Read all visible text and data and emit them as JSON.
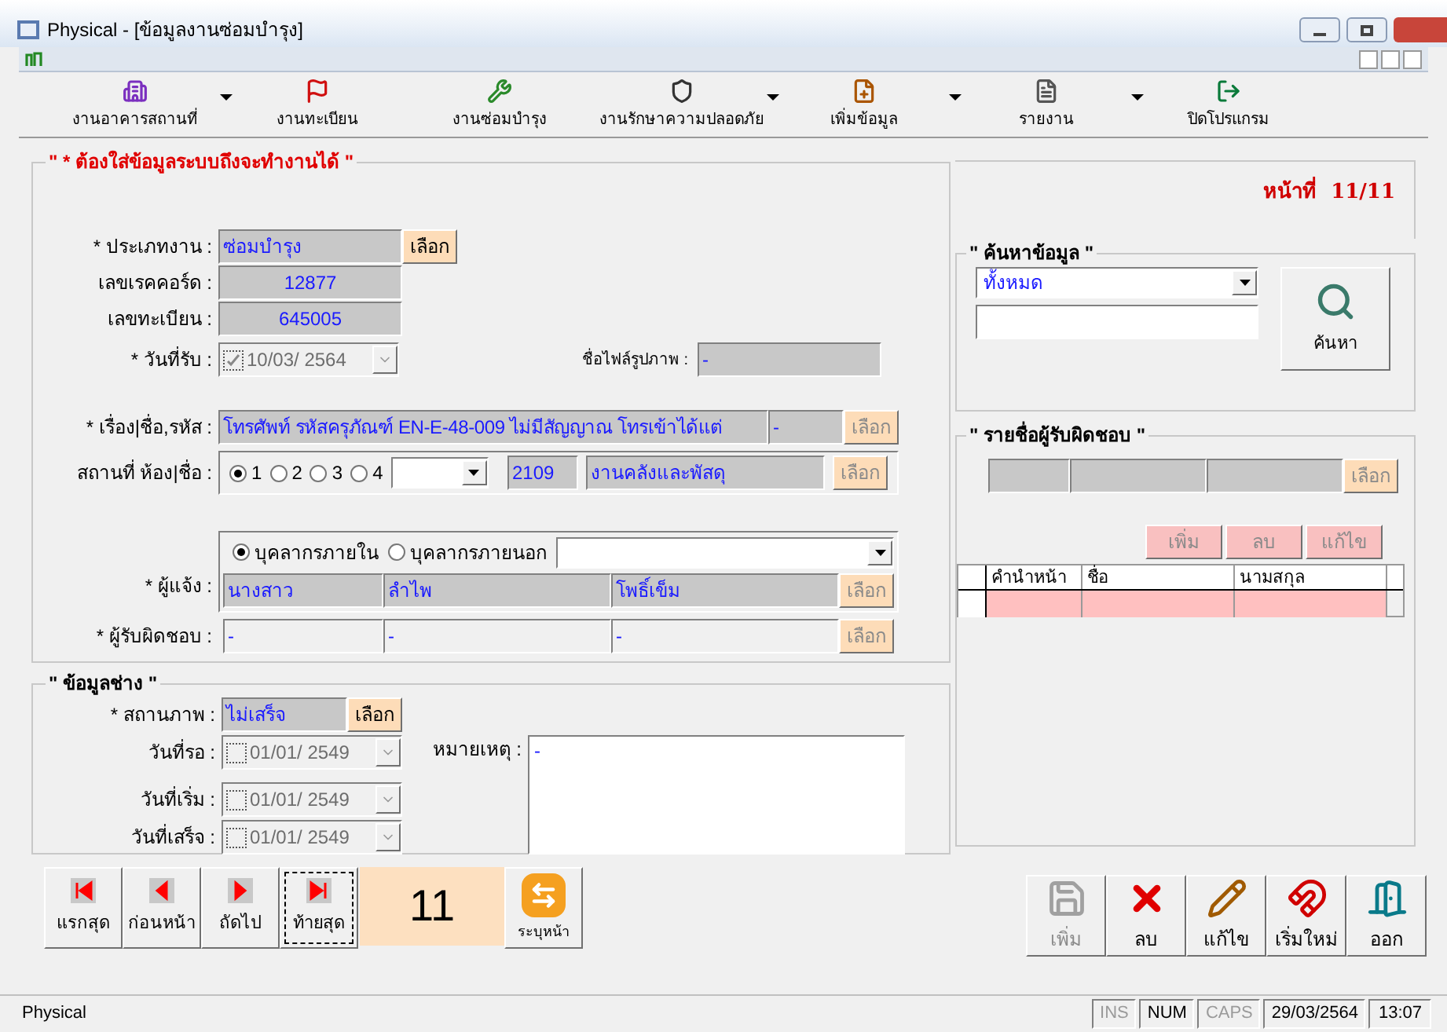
{
  "window": {
    "title": "Physical - [ข้อมูลงานซ่อมบำรุง]"
  },
  "toolbar": [
    {
      "label": "งานอาคารสถานที่",
      "kind": "building",
      "dropdown": true
    },
    {
      "label": "งานทะเบียน",
      "kind": "register",
      "dropdown": false
    },
    {
      "label": "งานซ่อมบำรุง",
      "kind": "repair",
      "dropdown": false
    },
    {
      "label": "งานรักษาความปลอดภัย",
      "kind": "security",
      "dropdown": true
    },
    {
      "label": "เพิ่มข้อมูล",
      "kind": "add",
      "dropdown": true
    },
    {
      "label": "รายงาน",
      "kind": "report",
      "dropdown": true
    },
    {
      "label": "ปิดโปรแกรม",
      "kind": "exit",
      "dropdown": false
    }
  ],
  "form": {
    "legend": "\" * ต้องใส่ข้อมูลระบบถึงจะทำงานได้ \"",
    "page": "หน้าที่  11/11",
    "job_type": {
      "label": "* ประเภทงาน :",
      "value": "ซ่อมบำรุง",
      "button": {
        "label": "เลือก",
        "disabled": false
      }
    },
    "record_no": {
      "label": "เลขเรคคอร์ด :",
      "value": "12877"
    },
    "register_no": {
      "label": "เลขทะเบียน :",
      "value": "645005"
    },
    "received_date": {
      "label": "* วันที่รับ :",
      "value": "10/03/ 2564",
      "checked": true
    },
    "image_file": {
      "label": "ชื่อไฟล์รูปภาพ :",
      "value": "-"
    },
    "subject": {
      "label": "* เรื่อง|ชื่อ,รหัส :",
      "value": "โทรศัพท์ รหัสครุภัณฑ์ EN-E-48-009 ไม่มีสัญญาณ โทรเข้าได้แต่",
      "code": "-",
      "button": {
        "label": "เลือก",
        "disabled": true
      }
    },
    "location": {
      "label": "สถานที่ ห้อง|ชื่อ :",
      "options": [
        {
          "label": "1",
          "selected": true
        },
        {
          "label": "2",
          "selected": false
        },
        {
          "label": "3",
          "selected": false
        },
        {
          "label": "4",
          "selected": false
        }
      ],
      "room": "2109",
      "name": "งานคลังและพัสดุ",
      "button": {
        "label": "เลือก",
        "disabled": true
      }
    },
    "staff_type": [
      {
        "label": "บุคลากรภายใน",
        "selected": true
      },
      {
        "label": "บุคลากรภายนอก",
        "selected": false
      }
    ],
    "reporter": {
      "label": "* ผู้แจ้ง :",
      "values": [
        "นางสาว",
        "ลำไพ",
        "โพธิ์เข็ม"
      ],
      "button": {
        "label": "เลือก",
        "disabled": true
      }
    },
    "responsible": {
      "label": "* ผู้รับผิดชอบ :",
      "values": [
        "-",
        "-",
        "-"
      ],
      "button": {
        "label": "เลือก",
        "disabled": true
      }
    }
  },
  "technician": {
    "legend": "\" ข้อมูลช่าง \"",
    "status": {
      "label": "* สถานภาพ :",
      "value": "ไม่เสร็จ",
      "button": {
        "label": "เลือก",
        "disabled": false
      }
    },
    "dates": [
      {
        "label": "วันที่รอ :",
        "value": "01/01/ 2549",
        "checked": false
      },
      {
        "label": "วันที่เริ่ม :",
        "value": "01/01/ 2549",
        "checked": false
      },
      {
        "label": "วันที่เสร็จ :",
        "value": "01/01/ 2549",
        "checked": false
      }
    ],
    "note": {
      "label": "หมายเหตุ :",
      "value": "-"
    }
  },
  "search": {
    "legend": "\" ค้นหาข้อมูล \"",
    "scope": "ทั้งหมด",
    "button": "ค้นหา"
  },
  "responsible_list": {
    "legend": "\" รายชื่อผู้รับผิดชอบ \"",
    "button": {
      "label": "เลือก",
      "disabled": true
    },
    "actions": [
      {
        "label": "เพิ่ม",
        "disabled": true
      },
      {
        "label": "ลบ",
        "disabled": true
      },
      {
        "label": "แก้ไข",
        "disabled": true
      }
    ],
    "columns": [
      "คำนำหน้า",
      "ชื่อ",
      "นามสกุล"
    ]
  },
  "navigation": {
    "buttons": [
      {
        "label": "แรกสุด",
        "kind": "first",
        "selected": false
      },
      {
        "label": "ก่อนหน้า",
        "kind": "prev",
        "selected": false
      },
      {
        "label": "ถัดไป",
        "kind": "next",
        "selected": false
      },
      {
        "label": "ท้ายสุด",
        "kind": "last",
        "selected": true
      }
    ],
    "page": "11",
    "goto": "ระบุหน้า"
  },
  "actions": [
    {
      "label": "เพิ่ม",
      "kind": "save",
      "disabled": true
    },
    {
      "label": "ลบ",
      "kind": "delete",
      "disabled": false
    },
    {
      "label": "แก้ไข",
      "kind": "edit",
      "disabled": false
    },
    {
      "label": "เริ่มใหม่",
      "kind": "reset",
      "disabled": false
    },
    {
      "label": "ออก",
      "kind": "exit",
      "disabled": false
    }
  ],
  "status_bar": {
    "app": "Physical",
    "indicators": [
      {
        "label": "INS",
        "on": false
      },
      {
        "label": "NUM",
        "on": true
      },
      {
        "label": "CAPS",
        "on": false
      }
    ],
    "date": "29/03/2564",
    "time": "13:07"
  }
}
